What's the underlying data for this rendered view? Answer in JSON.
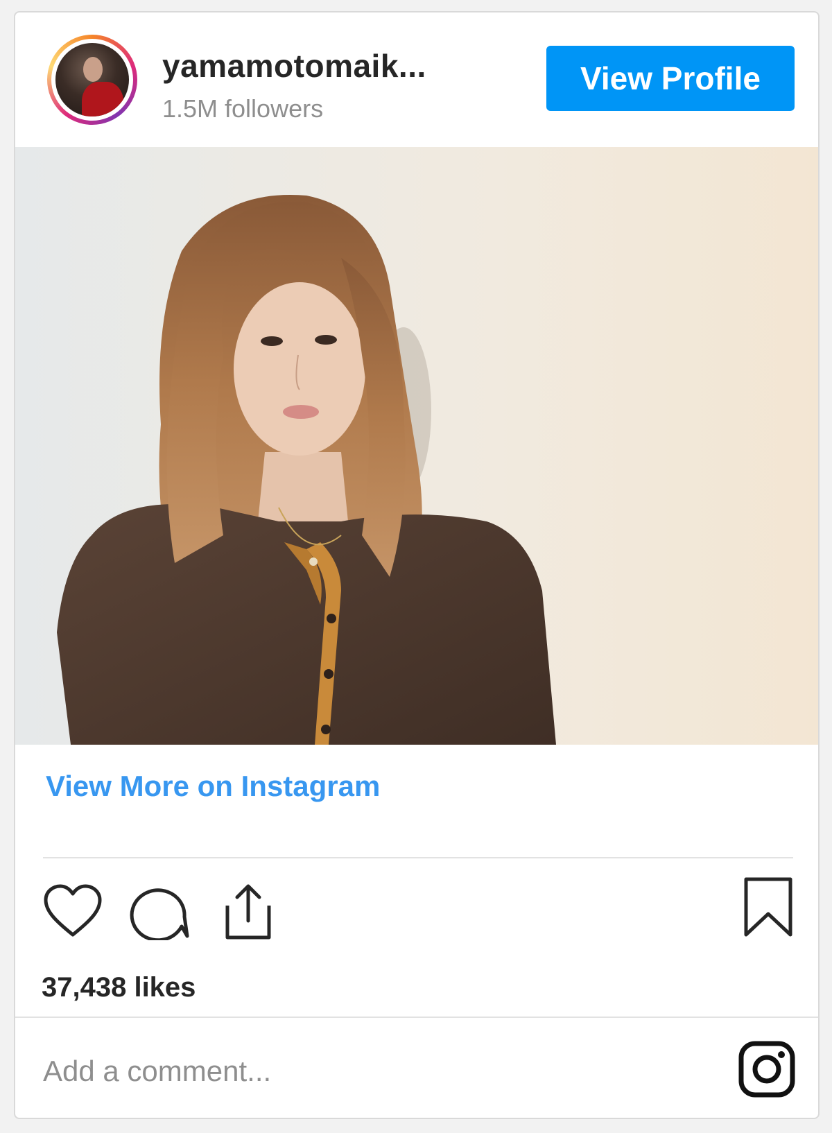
{
  "header": {
    "username": "yamamotomaik...",
    "followers": "1.5M followers",
    "view_profile_label": "View Profile"
  },
  "post": {
    "image_icon": "portrait-photo"
  },
  "links": {
    "view_more": "View More on Instagram"
  },
  "actions": {
    "icons": [
      "heart-icon",
      "comment-icon",
      "share-icon",
      "bookmark-icon"
    ]
  },
  "likes": "37,438 likes",
  "comment": {
    "placeholder": "Add a comment..."
  },
  "colors": {
    "accent": "#0095f6",
    "link": "#3897f0",
    "text": "#262626",
    "muted": "#8e8e8e"
  }
}
